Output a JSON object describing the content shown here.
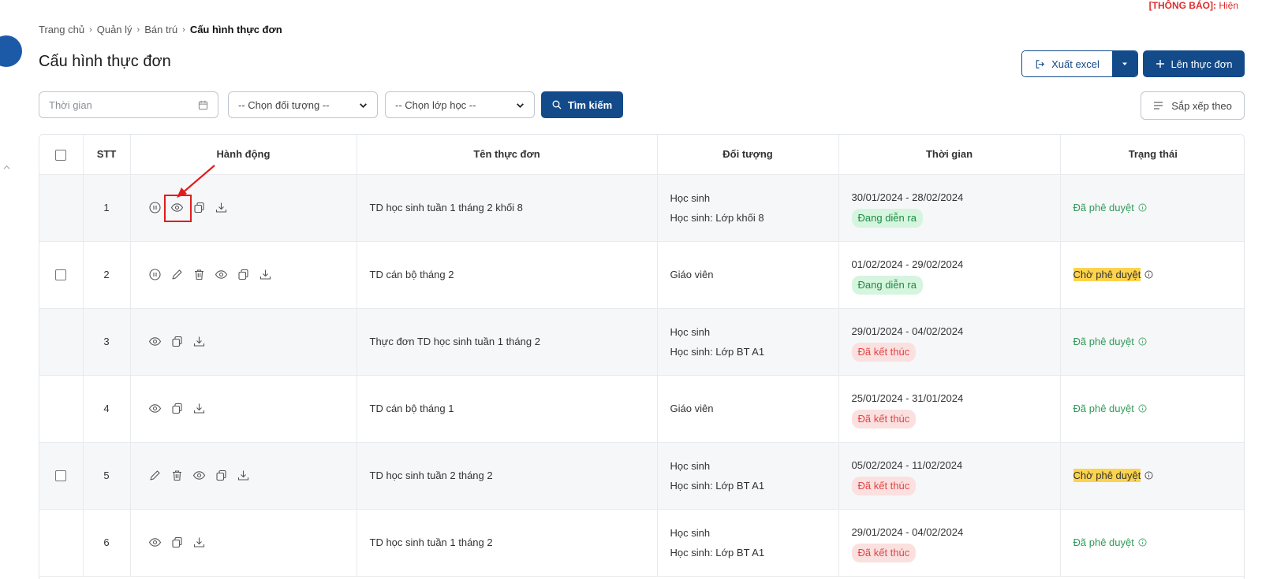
{
  "notice": {
    "label": "[THÔNG BÁO]:",
    "value": "Hiện"
  },
  "breadcrumb": [
    {
      "label": "Trang chủ"
    },
    {
      "label": "Quản lý"
    },
    {
      "label": "Bán trú"
    },
    {
      "label": "Cấu hình thực đơn",
      "current": true
    }
  ],
  "page": {
    "title": "Cấu hình thực đơn"
  },
  "toolbar": {
    "export_label": "Xuất excel",
    "add_label": "Lên thực đơn",
    "sort_label": "Sắp xếp theo"
  },
  "filters": {
    "date_placeholder": "Thời gian",
    "object_select": "-- Chọn đối tượng --",
    "class_select": "-- Chọn lớp học --",
    "search_label": "Tìm kiếm"
  },
  "table": {
    "headers": [
      "STT",
      "Hành động",
      "Tên thực đơn",
      "Đối tượng",
      "Thời gian",
      "Trạng thái"
    ],
    "rows": [
      {
        "stt": "1",
        "checkbox": false,
        "actions": [
          "pause",
          "view",
          "copy",
          "download"
        ],
        "highlight": "view",
        "name": "TD học sinh tuần 1 tháng 2 khối 8",
        "object": [
          "Học sinh",
          "Học sinh: Lớp khối 8"
        ],
        "time": "30/01/2024 - 28/02/2024",
        "period": "Đang diễn ra",
        "period_kind": "ongoing",
        "status": "Đã phê duyệt",
        "status_kind": "approved"
      },
      {
        "stt": "2",
        "checkbox": true,
        "actions": [
          "pause",
          "edit",
          "delete",
          "view",
          "copy",
          "download"
        ],
        "name": "TD cán bộ tháng 2",
        "object": [
          "Giáo viên"
        ],
        "time": "01/02/2024 - 29/02/2024",
        "period": "Đang diễn ra",
        "period_kind": "ongoing",
        "status": "Chờ phê duyệt",
        "status_kind": "pending"
      },
      {
        "stt": "3",
        "checkbox": false,
        "actions": [
          "view",
          "copy",
          "download"
        ],
        "name": "Thực đơn TD học sinh tuần 1 tháng 2",
        "object": [
          "Học sinh",
          "Học sinh: Lớp BT A1"
        ],
        "time": "29/01/2024 - 04/02/2024",
        "period": "Đã kết thúc",
        "period_kind": "ended",
        "status": "Đã phê duyệt",
        "status_kind": "approved"
      },
      {
        "stt": "4",
        "checkbox": false,
        "actions": [
          "view",
          "copy",
          "download"
        ],
        "name": "TD cán bộ tháng 1",
        "object": [
          "Giáo viên"
        ],
        "time": "25/01/2024 - 31/01/2024",
        "period": "Đã kết thúc",
        "period_kind": "ended",
        "status": "Đã phê duyệt",
        "status_kind": "approved"
      },
      {
        "stt": "5",
        "checkbox": true,
        "actions": [
          "edit",
          "delete",
          "view",
          "copy",
          "download"
        ],
        "name": "TD học sinh tuần 2 tháng 2",
        "object": [
          "Học sinh",
          "Học sinh: Lớp BT A1"
        ],
        "time": "05/02/2024 - 11/02/2024",
        "period": "Đã kết thúc",
        "period_kind": "ended",
        "status": "Chờ phê duyệt",
        "status_kind": "pending"
      },
      {
        "stt": "6",
        "checkbox": false,
        "actions": [
          "view",
          "copy",
          "download"
        ],
        "name": "TD học sinh tuần 1 tháng 2",
        "object": [
          "Học sinh",
          "Học sinh: Lớp BT A1"
        ],
        "time": "29/01/2024 - 04/02/2024",
        "period": "Đã kết thúc",
        "period_kind": "ended",
        "status": "Đã phê duyệt",
        "status_kind": "approved"
      }
    ]
  },
  "icons": {
    "pause": "pause-circle-icon",
    "edit": "pencil-icon",
    "delete": "trash-icon",
    "view": "eye-icon",
    "copy": "copy-icon",
    "download": "download-icon"
  },
  "colors": {
    "primary": "#134a8a",
    "approved": "#2e9b56",
    "pending_highlight": "#fcd34d",
    "ongoing_bg": "#d6f5de",
    "ended_bg": "#fbe0e0",
    "annotation": "#e31b1b"
  }
}
